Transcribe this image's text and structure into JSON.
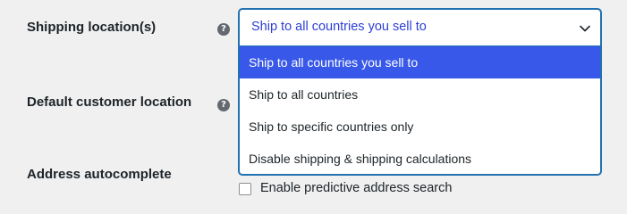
{
  "settings": {
    "shipping_location_label": "Shipping location(s)",
    "default_customer_location_label": "Default customer location",
    "address_autocomplete_label": "Address autocomplete",
    "help_icon_glyph": "?"
  },
  "shipping_select": {
    "selected_value": "Ship to all countries you sell to",
    "options": [
      "Ship to all countries you sell to",
      "Ship to all countries",
      "Ship to specific countries only",
      "Disable shipping & shipping calculations"
    ],
    "highlighted_index": 0
  },
  "address_autocomplete": {
    "checkbox_label": "Enable predictive address search",
    "checked": false
  },
  "icons": {
    "help": "help-icon",
    "chevron": "chevron-down-icon"
  },
  "colors": {
    "page_background": "#f0f0f1",
    "focus_border": "#2271b1",
    "selected_value_text": "#2c3ed6",
    "highlighted_option_background": "#3858e9",
    "help_icon_background": "#646970"
  }
}
